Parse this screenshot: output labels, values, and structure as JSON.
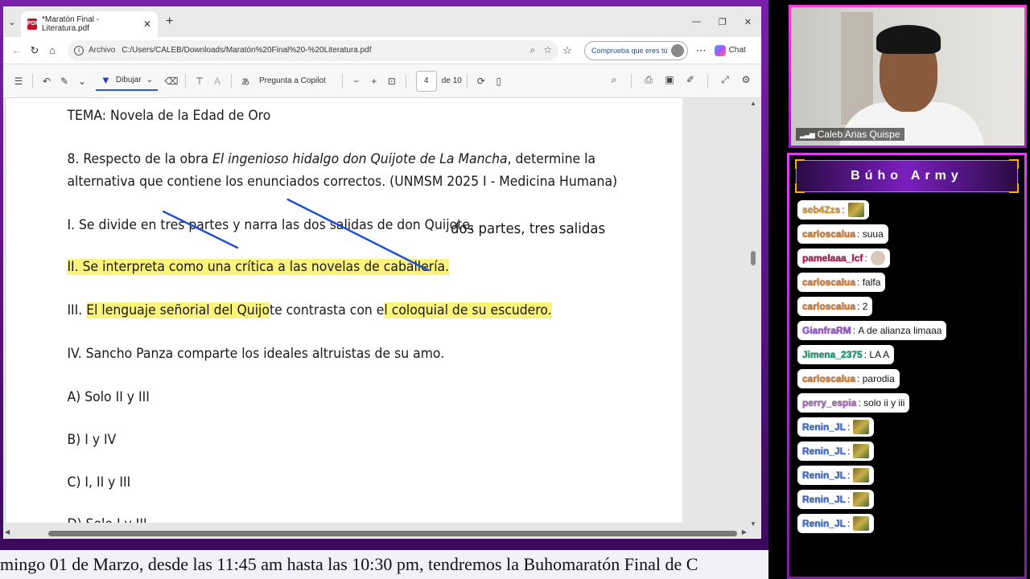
{
  "browser": {
    "tab_title": "*Maratón Final - Literatura.pdf",
    "url_label": "Archivo",
    "url": "C:/Users/CALEB/Downloads/Maratón%20Final%20-%20Literatura.pdf",
    "verify_label": "Comprueba que eres tú",
    "chat_label": "Chat"
  },
  "pdf_toolbar": {
    "draw_label": "Dibujar",
    "copilot_label": "Pregunta a Copilot",
    "page_current": "4",
    "page_total": "de 10"
  },
  "document": {
    "topic": "TEMA: Novela de la Edad de Oro",
    "question_line1_a": "8. Respecto de la obra ",
    "question_line1_italic": "El ingenioso hidalgo don Quijote de La Mancha",
    "question_line1_b": ", determine la",
    "question_line2": "alternativa que contiene los enunciados correctos. (UNMSM 2025 I - Medicina Humana)",
    "stmt1": "I. Se divide en tres partes y narra las dos salidas de don Quijote.",
    "annotation": "dos partes,  tres salidas",
    "stmt2": "II. Se interpreta como una crítica a las novelas de caballería.",
    "stmt3_a": "III. ",
    "stmt3_b": "El lenguaje señorial del Quijo",
    "stmt3_c": "te contrasta con e",
    "stmt3_d": "l coloquial de su escudero.",
    "stmt4": "IV. Sancho Panza comparte los ideales altruistas de su amo.",
    "optA": "A) Solo II y III",
    "optB": "B) I y IV",
    "optC": "C) I, II y III",
    "optD": "D) Solo I y III"
  },
  "webcam": {
    "name": "Caleb Arias Quispe"
  },
  "chat": {
    "title": "Búho Army",
    "messages": [
      {
        "user": "seb4Zzs",
        "color": "#e0a030",
        "text": "",
        "emote": true
      },
      {
        "user": "carloscalua",
        "color": "#e07b2a",
        "text": "suua",
        "emote": false
      },
      {
        "user": "pamelaaa_lcf",
        "color": "#c2185b",
        "text": "",
        "emote": "round"
      },
      {
        "user": "carloscalua",
        "color": "#e07b2a",
        "text": "falfa",
        "emote": false
      },
      {
        "user": "carloscalua",
        "color": "#e07b2a",
        "text": "2",
        "emote": false
      },
      {
        "user": "GianfraRM",
        "color": "#9c4fd6",
        "text": "A de alianza limaaa",
        "emote": false
      },
      {
        "user": "Jimena_2375",
        "color": "#1aa37a",
        "text": "LA A",
        "emote": false
      },
      {
        "user": "carloscalua",
        "color": "#e07b2a",
        "text": "parodia",
        "emote": false
      },
      {
        "user": "perry_espia",
        "color": "#b06abf",
        "text": "solo ii y iii",
        "emote": false
      },
      {
        "user": "Renin_JL",
        "color": "#3a6fd8",
        "text": "",
        "emote": true
      },
      {
        "user": "Renin_JL",
        "color": "#3a6fd8",
        "text": "",
        "emote": true
      },
      {
        "user": "Renin_JL",
        "color": "#3a6fd8",
        "text": "",
        "emote": true
      },
      {
        "user": "Renin_JL",
        "color": "#3a6fd8",
        "text": "",
        "emote": true
      },
      {
        "user": "Renin_JL",
        "color": "#3a6fd8",
        "text": "",
        "emote": true
      }
    ]
  },
  "ticker": {
    "text": "mingo 01 de Marzo, desde las 11:45 am hasta las 10:30 pm, tendremos la Buhomaratón Final de C"
  },
  "colors": {
    "highlight": "#fbf37a",
    "pen": "#1f4fd0",
    "frame": "#7a1fa8"
  }
}
